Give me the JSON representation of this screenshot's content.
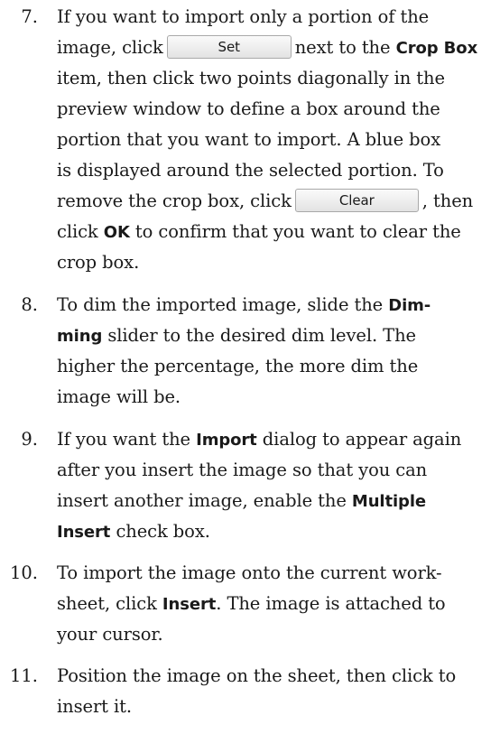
{
  "steps": [
    {
      "number": "7.",
      "lines": [
        [
          "If you want to import only a portion of the"
        ],
        [
          "image, click",
          {
            "button": "Set"
          },
          "next to the",
          {
            "bold": "Crop Box"
          }
        ],
        [
          "item, then click two points diagonally in the"
        ],
        [
          "preview window to define a box around the"
        ],
        [
          "portion that you want to import. A blue box"
        ],
        [
          "is displayed around the selected portion. To"
        ],
        [
          "remove the crop box, click",
          {
            "button": "Clear"
          },
          ", then"
        ],
        [
          "click",
          {
            "bold": "OK"
          },
          "to confirm that you want to clear the"
        ],
        [
          "crop box."
        ]
      ]
    },
    {
      "number": "8.",
      "lines": [
        [
          "To dim the imported image, slide the",
          {
            "bold": "Dim-"
          }
        ],
        [
          {
            "bold": "ming"
          },
          "slider to the desired dim level. The"
        ],
        [
          "higher the percentage, the more dim the"
        ],
        [
          "image will be."
        ]
      ]
    },
    {
      "number": "9.",
      "lines": [
        [
          "If you want the",
          {
            "bold": "Import"
          },
          "dialog to appear again"
        ],
        [
          "after you insert the image so that you can"
        ],
        [
          "insert another image, enable the",
          {
            "bold": "Multiple"
          }
        ],
        [
          {
            "bold": "Insert"
          },
          "check box."
        ]
      ]
    },
    {
      "number": "10.",
      "lines": [
        [
          "To import the image onto the current work-"
        ],
        [
          "sheet, click",
          {
            "bold": "Insert"
          },
          ". The image is attached to"
        ],
        [
          "your cursor."
        ]
      ]
    },
    {
      "number": "11.",
      "lines": [
        [
          "Position the image on the sheet, then click to"
        ],
        [
          "insert it."
        ]
      ]
    }
  ]
}
